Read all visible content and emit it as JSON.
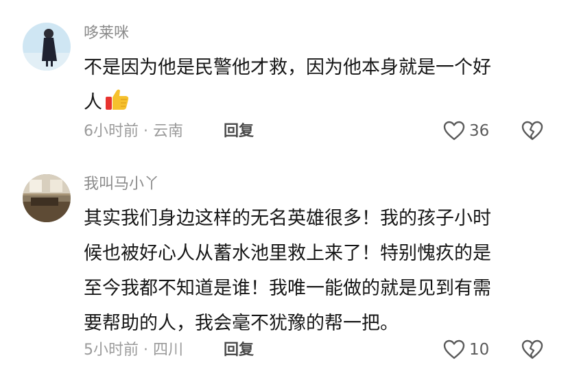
{
  "comments": [
    {
      "username": "哆莱咪",
      "text_line1": "不是因为他是民警他才救，因为他本身就是一个好",
      "text_line2": "人",
      "emoji_icon": "thumbs-up-icon",
      "time_location": "6小时前 · 云南",
      "reply_label": "回复",
      "like_count": "36"
    },
    {
      "username": "我叫马小丫",
      "text_lines": [
        "其实我们身边这样的无名英雄很多！我的孩子小时",
        "候也被好心人从蓄水池里救上来了！特别愧疚的是",
        "至今我都不知道是谁！我唯一能做的就是见到有需",
        "要帮助的人，我会毫不犹豫的帮一把。"
      ],
      "time_location": "5小时前 · 四川",
      "reply_label": "回复",
      "like_count": "10"
    }
  ],
  "colors": {
    "username": "#8a8a8a",
    "meta": "#9a9a9a",
    "text": "#161616",
    "icon": "#5a5a5a"
  }
}
